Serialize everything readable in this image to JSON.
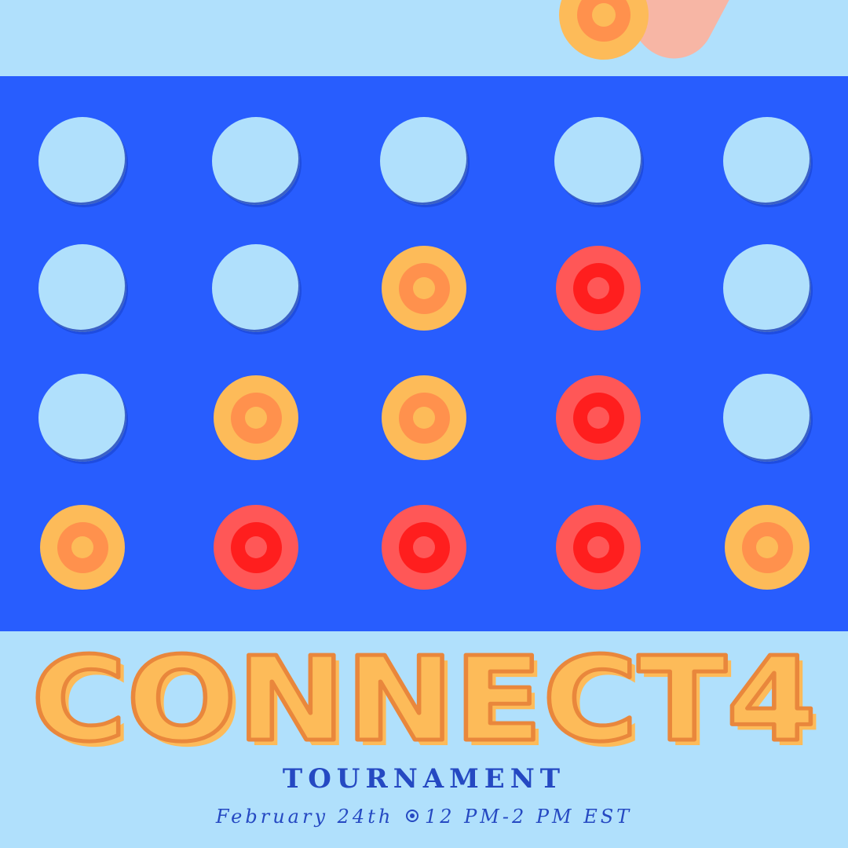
{
  "poster": {
    "title": "CONNECT4",
    "subtitle": "TOURNAMENT",
    "date": "February 24th",
    "time": "12 PM-2 PM EST"
  },
  "colors": {
    "sky": "#B0E0FC",
    "board": "#285DFE",
    "text_blue": "#2549C2",
    "yellow_outer": "#FDBB59",
    "yellow_mid": "#FF914D",
    "yellow_inner": "#FDBB59",
    "red_outer": "#FF5757",
    "red_mid": "#FF1E1E",
    "red_inner": "#FF5757",
    "title_fill": "#FDBB59",
    "title_outline": "#E9873C"
  },
  "board": {
    "rows": 4,
    "columns": 5,
    "cells": [
      [
        "empty",
        "empty",
        "empty",
        "empty",
        "empty"
      ],
      [
        "empty",
        "empty",
        "yellow",
        "red",
        "empty"
      ],
      [
        "empty",
        "yellow",
        "yellow",
        "red",
        "empty"
      ],
      [
        "yellow",
        "red",
        "red",
        "red",
        "yellow"
      ]
    ]
  },
  "dropping_disc": {
    "color": "yellow"
  },
  "icons": {
    "separator": "bullet-circle-icon",
    "hand": "hand-icon"
  }
}
